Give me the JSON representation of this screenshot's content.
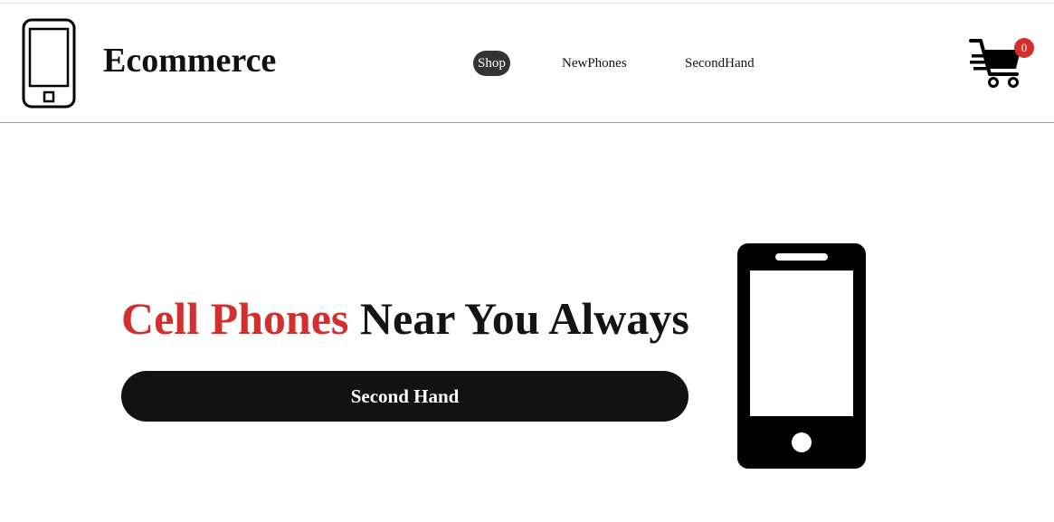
{
  "header": {
    "brand": "Ecommerce",
    "nav": [
      {
        "label": "Shop",
        "active": true
      },
      {
        "label": "NewPhones",
        "active": false
      },
      {
        "label": "SecondHand",
        "active": false
      }
    ],
    "cart": {
      "count": "0",
      "icon": "shopping-cart-icon"
    },
    "logo_icon": "smartphone-outline-icon"
  },
  "hero": {
    "title_accent": "Cell Phones",
    "title_rest": " Near You Always",
    "button_label": "Second Hand",
    "image_icon": "smartphone-icon"
  },
  "colors": {
    "accent": "#d32f2f",
    "dark": "#121212",
    "nav_active_bg": "#333333"
  }
}
